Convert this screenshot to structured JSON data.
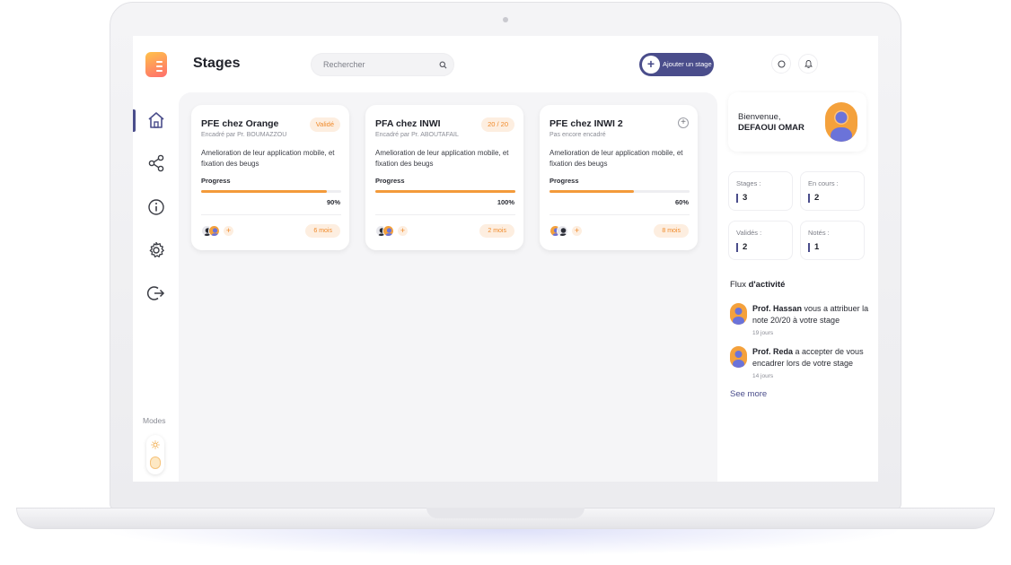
{
  "header": {
    "title": "Stages",
    "search_placeholder": "Rechercher",
    "add_button_label": "Ajouter un stage"
  },
  "sidebar": {
    "items": [
      {
        "icon": "home-icon",
        "active": true
      },
      {
        "icon": "share-icon",
        "active": false
      },
      {
        "icon": "info-icon",
        "active": false
      },
      {
        "icon": "gear-icon",
        "active": false
      },
      {
        "icon": "logout-icon",
        "active": false
      }
    ],
    "modes_label": "Modes"
  },
  "cards": [
    {
      "title": "PFE chez Orange",
      "subtitle": "Encadré par Pr. BOUMAZZOU",
      "badge": "Validé",
      "description": "Amelioration de leur application mobile, et fixation des beugs",
      "progress_label": "Progress",
      "progress_text": "90%",
      "progress": 0.9,
      "duration": "6 mois"
    },
    {
      "title": "PFA chez INWI",
      "subtitle": "Encadré par Pr. ABOUTAFAIL",
      "badge": "20 / 20",
      "description": "Amelioration de leur application mobile, et fixation des beugs",
      "progress_label": "Progress",
      "progress_text": "100%",
      "progress": 1.0,
      "duration": "2 mois"
    },
    {
      "title": "PFE chez INWI 2",
      "subtitle": "Pas encore encadré",
      "badge": "",
      "description": "Amelioration de leur application mobile, et fixation des beugs",
      "progress_label": "Progress",
      "progress_text": "60%",
      "progress": 0.6,
      "duration": "8 mois"
    }
  ],
  "welcome": {
    "greeting": "Bienvenue,",
    "name": "DEFAOUI OMAR"
  },
  "stats": [
    {
      "label": "Stages :",
      "value": "3"
    },
    {
      "label": "En cours :",
      "value": "2"
    },
    {
      "label": "Validés :",
      "value": "2"
    },
    {
      "label": "Notés :",
      "value": "1"
    }
  ],
  "feed": {
    "title_plain": "Flux ",
    "title_bold": "d'activité",
    "items": [
      {
        "author": "Prof. Hassan",
        "text": " vous a attribuer la note 20/20 à votre stage",
        "time": "19 jours"
      },
      {
        "author": "Prof. Reda",
        "text": " a accepter de vous encadrer lors de votre stage",
        "time": "14 jours"
      }
    ],
    "see_more": "See more"
  },
  "colors": {
    "accent": "#4a4d8b",
    "orange": "#f39a3a",
    "badge_bg": "#fdeee0"
  }
}
